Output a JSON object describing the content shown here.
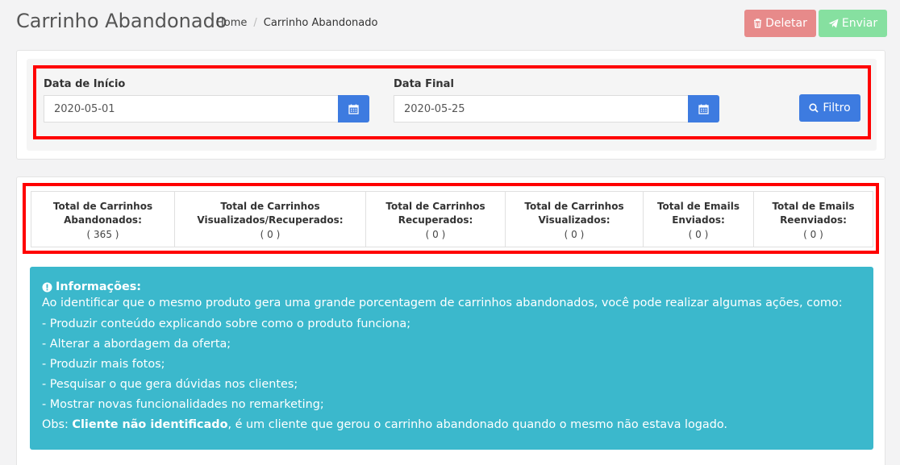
{
  "header": {
    "title": "Carrinho Abandonado",
    "breadcrumb": {
      "home": "Home",
      "separator": "/",
      "current": "Carrinho Abandonado"
    },
    "delete_label": "Deletar",
    "send_label": "Enviar"
  },
  "filter": {
    "start_label": "Data de Início",
    "start_value": "2020-05-01",
    "end_label": "Data Final",
    "end_value": "2020-05-25",
    "filter_label": "Filtro"
  },
  "stats": [
    {
      "label_line1": "Total de Carrinhos",
      "label_line2": "Abandonados:",
      "value": "( 365 )"
    },
    {
      "label_line1": "Total de Carrinhos",
      "label_line2": "Visualizados/Recuperados:",
      "value": "( 0 )"
    },
    {
      "label_line1": "Total de Carrinhos",
      "label_line2": "Recuperados:",
      "value": "( 0 )"
    },
    {
      "label_line1": "Total de Carrinhos",
      "label_line2": "Visualizados:",
      "value": "( 0 )"
    },
    {
      "label_line1": "Total de Emails",
      "label_line2": "Enviados:",
      "value": "( 0 )"
    },
    {
      "label_line1": "Total de Emails",
      "label_line2": "Reenviados:",
      "value": "( 0 )"
    }
  ],
  "info": {
    "title": "Informações:",
    "intro": "Ao identificar que o mesmo produto gera uma grande porcentagem de carrinhos abandonados, você pode realizar algumas ações, como:",
    "items": [
      "- Produzir conteúdo explicando sobre como o produto funciona;",
      "- Alterar a abordagem da oferta;",
      "- Produzir mais fotos;",
      "- Pesquisar o que gera dúvidas nos clientes;",
      "- Mostrar novas funcionalidades no remarketing;"
    ],
    "obs_prefix": "Obs: ",
    "obs_bold": "Cliente não identificado",
    "obs_rest": ", é um cliente que gerou o carrinho abandonado quando o mesmo não estava logado."
  },
  "colors": {
    "primary": "#3d7be0",
    "danger": "#e78a8a",
    "success": "#86e0a0",
    "info": "#3bb8cc",
    "highlight": "#ff0000"
  },
  "icons": {
    "delete": "trash-icon",
    "send": "paper-plane-icon",
    "calendar": "calendar-icon",
    "filter": "search-icon",
    "info": "exclamation-circle-icon"
  }
}
